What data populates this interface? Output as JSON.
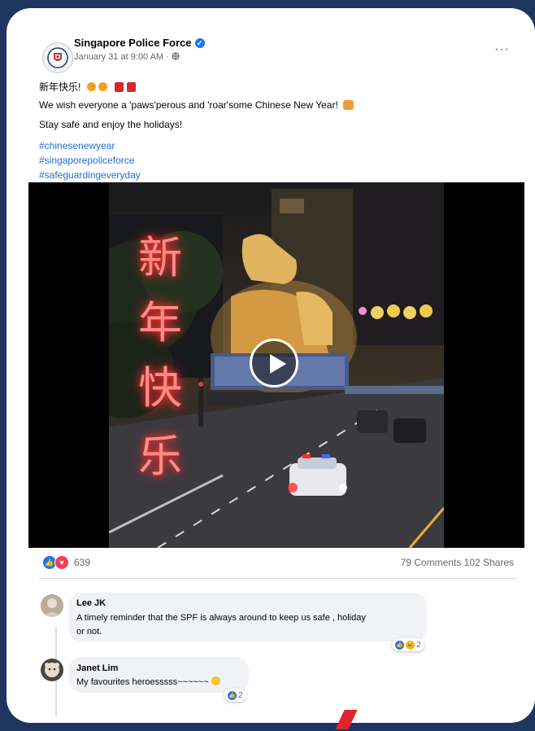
{
  "post": {
    "page_name": "Singapore Police Force",
    "timestamp": "January 31 at 9:00 AM",
    "more_icon": "···",
    "line1": "新年快乐!",
    "line2": "We wish everyone a 'paws'perous and 'roar'some Chinese New Year!",
    "line3": "Stay safe and enjoy the holidays!",
    "hashtags": [
      "#chinesenewyear",
      "#singaporepoliceforce",
      "#safeguardingeveryday"
    ]
  },
  "video": {
    "overlay_text": [
      "新",
      "年",
      "快",
      "乐"
    ]
  },
  "engagement": {
    "reaction_count": "639",
    "comments": "79 Comments",
    "shares": "102 Shares"
  },
  "comments": [
    {
      "author": "Lee JK",
      "text_line1": "A timely reminder that the SPF is always around to keep us safe , holiday",
      "text_line2": "or not.",
      "reaction_count": "2"
    },
    {
      "author": "Janet Lim",
      "text": "My favourites heroesssss~~~~~~",
      "reaction_count": "2"
    }
  ],
  "colors": {
    "background": "#1f3560",
    "link": "#216fdb",
    "like": "#1877f2",
    "love": "#f33e58",
    "neon": "#ff6a6a"
  }
}
